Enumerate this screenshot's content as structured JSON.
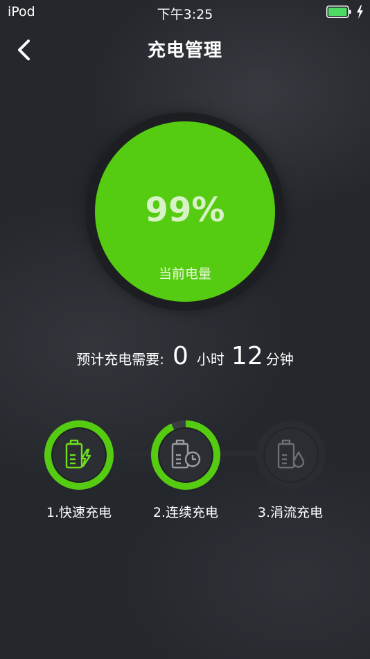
{
  "status_bar": {
    "carrier": "iPod",
    "time": "下午3:25"
  },
  "nav": {
    "title": "充电管理",
    "back_icon": "chevron-left-icon"
  },
  "battery": {
    "percent_text": "99%",
    "level": 0.99,
    "label": "当前电量"
  },
  "estimate": {
    "prefix": "预计充电需要:",
    "hours": "0",
    "hours_unit": "小时",
    "minutes": "12",
    "minutes_unit": "分钟"
  },
  "stages": [
    {
      "label": "1.快速充电",
      "icon": "battery-bolt-icon",
      "progress": 1.0,
      "state": "complete"
    },
    {
      "label": "2.连续充电",
      "icon": "battery-clock-icon",
      "progress": 0.93,
      "state": "active"
    },
    {
      "label": "3.涓流充电",
      "icon": "battery-drop-icon",
      "progress": 0.0,
      "state": "inactive"
    }
  ],
  "colors": {
    "accent": "#55cc11",
    "bright_accent": "#6ee01e",
    "background": "#24272c",
    "inactive": "#3a3d42"
  }
}
